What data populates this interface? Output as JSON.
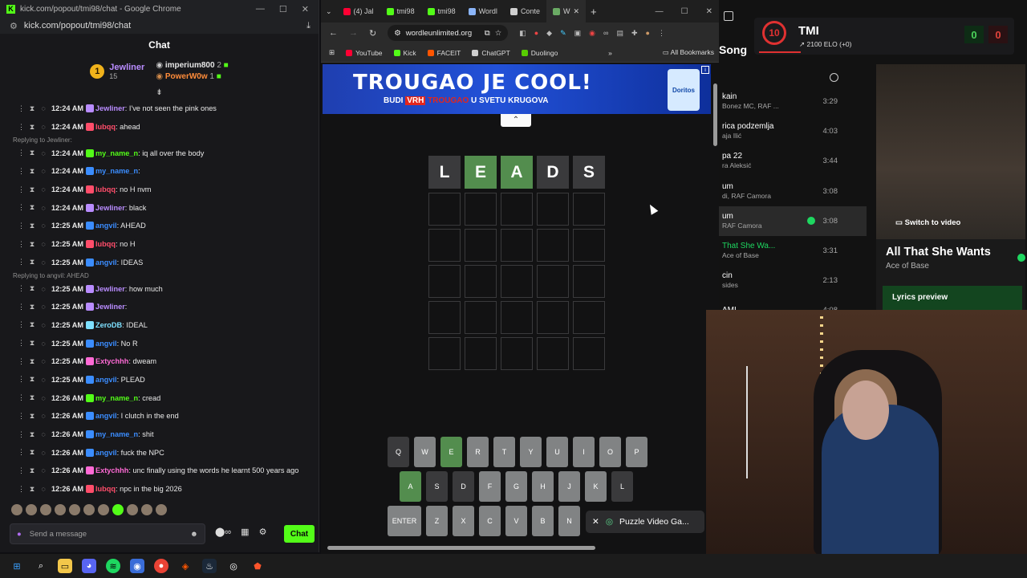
{
  "kick": {
    "window_title": "kick.com/popout/tmi98/chat - Google Chrome",
    "url": "kick.com/popout/tmi98/chat",
    "header": "Chat",
    "leaderboard": {
      "top_name": "Jewliner",
      "top_rank": "1",
      "top_count": "15",
      "second_name": "imperium800",
      "second_count": "2",
      "third_name": "PowerW0w",
      "third_count": "1"
    },
    "messages": [
      {
        "time": "12:24 AM",
        "user": "Jewliner",
        "user_color": "#b98cff",
        "text": ": I've not seen the pink ones"
      },
      {
        "time": "12:24 AM",
        "user": "lubqq",
        "user_color": "#ff4d6a",
        "text": ": ahead"
      },
      {
        "reply": "Replying to Jewliner:"
      },
      {
        "time": "12:24 AM",
        "user": "my_name_n",
        "user_color": "#53fc18",
        "text": ": iq all over the body"
      },
      {
        "time": "12:24 AM",
        "user": "my_name_n",
        "user_color": "#3b8dff",
        "text": ":"
      },
      {
        "time": "12:24 AM",
        "user": "lubqq",
        "user_color": "#ff4d6a",
        "text": ": no H nvm"
      },
      {
        "time": "12:24 AM",
        "user": "Jewliner",
        "user_color": "#b98cff",
        "text": ": black"
      },
      {
        "time": "12:25 AM",
        "user": "angvil",
        "user_color": "#3b8dff",
        "text": ": AHEAD"
      },
      {
        "time": "12:25 AM",
        "user": "lubqq",
        "user_color": "#ff4d6a",
        "text": ": no H"
      },
      {
        "time": "12:25 AM",
        "user": "angvil",
        "user_color": "#3b8dff",
        "text": ": IDEAS"
      },
      {
        "reply": "Replying to angvil: AHEAD"
      },
      {
        "time": "12:25 AM",
        "user": "Jewliner",
        "user_color": "#b98cff",
        "text": ": how much"
      },
      {
        "time": "12:25 AM",
        "user": "Jewliner",
        "user_color": "#b98cff",
        "text": ":"
      },
      {
        "time": "12:25 AM",
        "user": "ZeroDB",
        "user_color": "#7ee0ff",
        "text": ": IDEAL"
      },
      {
        "time": "12:25 AM",
        "user": "angvil",
        "user_color": "#3b8dff",
        "text": ": No R"
      },
      {
        "time": "12:25 AM",
        "user": "Extychhh",
        "user_color": "#ff6ad5",
        "text": ": dweam"
      },
      {
        "time": "12:25 AM",
        "user": "angvil",
        "user_color": "#3b8dff",
        "text": ": PLEAD"
      },
      {
        "time": "12:26 AM",
        "user": "my_name_n",
        "user_color": "#53fc18",
        "text": ": cread"
      },
      {
        "time": "12:26 AM",
        "user": "angvil",
        "user_color": "#3b8dff",
        "text": ": I clutch in the end"
      },
      {
        "time": "12:26 AM",
        "user": "my_name_n",
        "user_color": "#3b8dff",
        "text": ": shit"
      },
      {
        "time": "12:26 AM",
        "user": "angvil",
        "user_color": "#3b8dff",
        "text": ": fuck the NPC"
      },
      {
        "time": "12:26 AM",
        "user": "Extychhh",
        "user_color": "#ff6ad5",
        "text": ": unc finally using the words he learnt 500 years ago"
      },
      {
        "time": "12:26 AM",
        "user": "lubqq",
        "user_color": "#ff4d6a",
        "text": ": npc in the big 2026"
      }
    ],
    "input_placeholder": "Send a message",
    "send_label": "Chat"
  },
  "chrome": {
    "tabs": [
      {
        "label": "(4) Jal",
        "color": "#ff0033"
      },
      {
        "label": "tmi98",
        "color": "#53fc18"
      },
      {
        "label": "tmi98",
        "color": "#53fc18"
      },
      {
        "label": "Wordl",
        "color": "#8ab4f8"
      },
      {
        "label": "Conte",
        "color": "#cfcfcf"
      },
      {
        "label": "W",
        "color": "#6aaa64"
      }
    ],
    "url": "wordleunlimited.org",
    "bookmarks": [
      "YouTube",
      "Kick",
      "FACEIT",
      "ChatGPT",
      "Duolingo"
    ],
    "all_bookmarks": "All Bookmarks",
    "ad": {
      "title": "TROUGAO JE COOL!",
      "sub_part1": "BUDI",
      "sub_highlight": "VRH",
      "sub_orange": "TROUGAO",
      "sub_part2": "U SVETU KRUGOVA",
      "brand": "Doritos"
    },
    "guess": [
      {
        "letter": "L",
        "state": "absent"
      },
      {
        "letter": "E",
        "state": "correct"
      },
      {
        "letter": "A",
        "state": "correct"
      },
      {
        "letter": "D",
        "state": "absent"
      },
      {
        "letter": "S",
        "state": "absent"
      }
    ],
    "keyboard_rows": [
      [
        {
          "k": "Q",
          "s": "absent"
        },
        {
          "k": "W",
          "s": ""
        },
        {
          "k": "E",
          "s": "green"
        },
        {
          "k": "R",
          "s": ""
        },
        {
          "k": "T",
          "s": ""
        },
        {
          "k": "Y",
          "s": ""
        },
        {
          "k": "U",
          "s": ""
        },
        {
          "k": "I",
          "s": ""
        },
        {
          "k": "O",
          "s": ""
        },
        {
          "k": "P",
          "s": ""
        }
      ],
      [
        {
          "k": "A",
          "s": "green"
        },
        {
          "k": "S",
          "s": "absent"
        },
        {
          "k": "D",
          "s": "absent"
        },
        {
          "k": "F",
          "s": ""
        },
        {
          "k": "G",
          "s": ""
        },
        {
          "k": "H",
          "s": ""
        },
        {
          "k": "J",
          "s": ""
        },
        {
          "k": "K",
          "s": ""
        },
        {
          "k": "L",
          "s": "absent"
        }
      ],
      [
        {
          "k": "ENTER",
          "s": "wide"
        },
        {
          "k": "Z",
          "s": ""
        },
        {
          "k": "X",
          "s": ""
        },
        {
          "k": "C",
          "s": ""
        },
        {
          "k": "V",
          "s": ""
        },
        {
          "k": "B",
          "s": ""
        },
        {
          "k": "N",
          "s": ""
        }
      ]
    ],
    "toast": "Puzzle Video Ga..."
  },
  "spotify": {
    "header": "Song",
    "tracks": [
      {
        "title": "kain",
        "artist": "Bonez MC, RAF ...",
        "duration": "3:29"
      },
      {
        "title": "rica podzemlja",
        "artist": "aja Ilić",
        "duration": "4:03"
      },
      {
        "title": "pa 22",
        "artist": "ra Aleksić",
        "duration": "3:44"
      },
      {
        "title": "um",
        "artist": "di, RAF Camora",
        "duration": "3:08"
      },
      {
        "title": "um",
        "artist": "RAF Camora",
        "duration": "3:08",
        "selected": true
      },
      {
        "title": "That She Wa...",
        "artist": "Ace of Base",
        "duration": "3:31",
        "green": true
      },
      {
        "title": "cin",
        "artist": "sides",
        "duration": "2:13"
      },
      {
        "title": "AMI",
        "artist": "",
        "duration": "4:08"
      }
    ],
    "now_playing": {
      "switch_label": "Switch to video",
      "title": "All That She Wants",
      "artist": "Ace of Base",
      "lyrics_label": "Lyrics preview"
    }
  },
  "faceit": {
    "level": "10",
    "name": "TMI",
    "elo": "2100 ELO (+0)",
    "wins": "0",
    "losses": "0"
  }
}
